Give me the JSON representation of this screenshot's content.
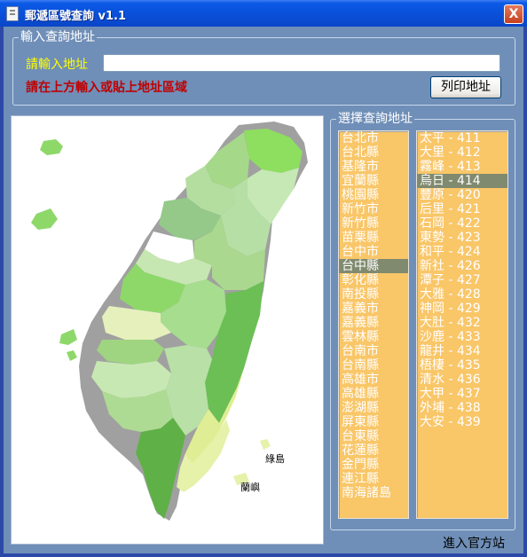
{
  "window": {
    "title": "郵遞區號查詢 v1.1",
    "close_label": "X"
  },
  "input_group": {
    "legend": "輸入查詢地址",
    "prompt_label": "請輸入地址",
    "address_value": "",
    "hint": "請在上方輸入或貼上地址區域",
    "print_button": "列印地址"
  },
  "select_group": {
    "legend": "選擇查詢地址"
  },
  "map": {
    "label_ludao": "綠島",
    "label_lanyu": "蘭嶼"
  },
  "counties": [
    {
      "label": "台北市"
    },
    {
      "label": "台北縣"
    },
    {
      "label": "基隆市"
    },
    {
      "label": "宜蘭縣"
    },
    {
      "label": "桃園縣"
    },
    {
      "label": "新竹市"
    },
    {
      "label": "新竹縣"
    },
    {
      "label": "苗栗縣"
    },
    {
      "label": "台中市"
    },
    {
      "label": "台中縣",
      "selected": true
    },
    {
      "label": "彰化縣"
    },
    {
      "label": "南投縣"
    },
    {
      "label": "嘉義市"
    },
    {
      "label": "嘉義縣"
    },
    {
      "label": "雲林縣"
    },
    {
      "label": "台南市"
    },
    {
      "label": "台南縣"
    },
    {
      "label": "高雄市"
    },
    {
      "label": "高雄縣"
    },
    {
      "label": "澎湖縣"
    },
    {
      "label": "屏東縣"
    },
    {
      "label": "台東縣"
    },
    {
      "label": "花蓮縣"
    },
    {
      "label": "金門縣"
    },
    {
      "label": "連江縣"
    },
    {
      "label": "南海諸島"
    }
  ],
  "districts": [
    {
      "label": "太平 - 411"
    },
    {
      "label": "大里 - 412"
    },
    {
      "label": "霧峰 - 413"
    },
    {
      "label": "烏日 - 414",
      "selected": true
    },
    {
      "label": "豐原 - 420"
    },
    {
      "label": "后里 - 421"
    },
    {
      "label": "石岡 - 422"
    },
    {
      "label": "東勢 - 423"
    },
    {
      "label": "和平 - 424"
    },
    {
      "label": "新社 - 426"
    },
    {
      "label": "潭子 - 427"
    },
    {
      "label": "大雅 - 428"
    },
    {
      "label": "神岡 - 429"
    },
    {
      "label": "大肚 - 432"
    },
    {
      "label": "沙鹿 - 433"
    },
    {
      "label": "龍井 - 434"
    },
    {
      "label": "梧棲 - 435"
    },
    {
      "label": "清水 - 436"
    },
    {
      "label": "大甲 - 437"
    },
    {
      "label": "外埔 - 438"
    },
    {
      "label": "大安 - 439"
    }
  ],
  "footer": {
    "link": "進入官方站"
  }
}
